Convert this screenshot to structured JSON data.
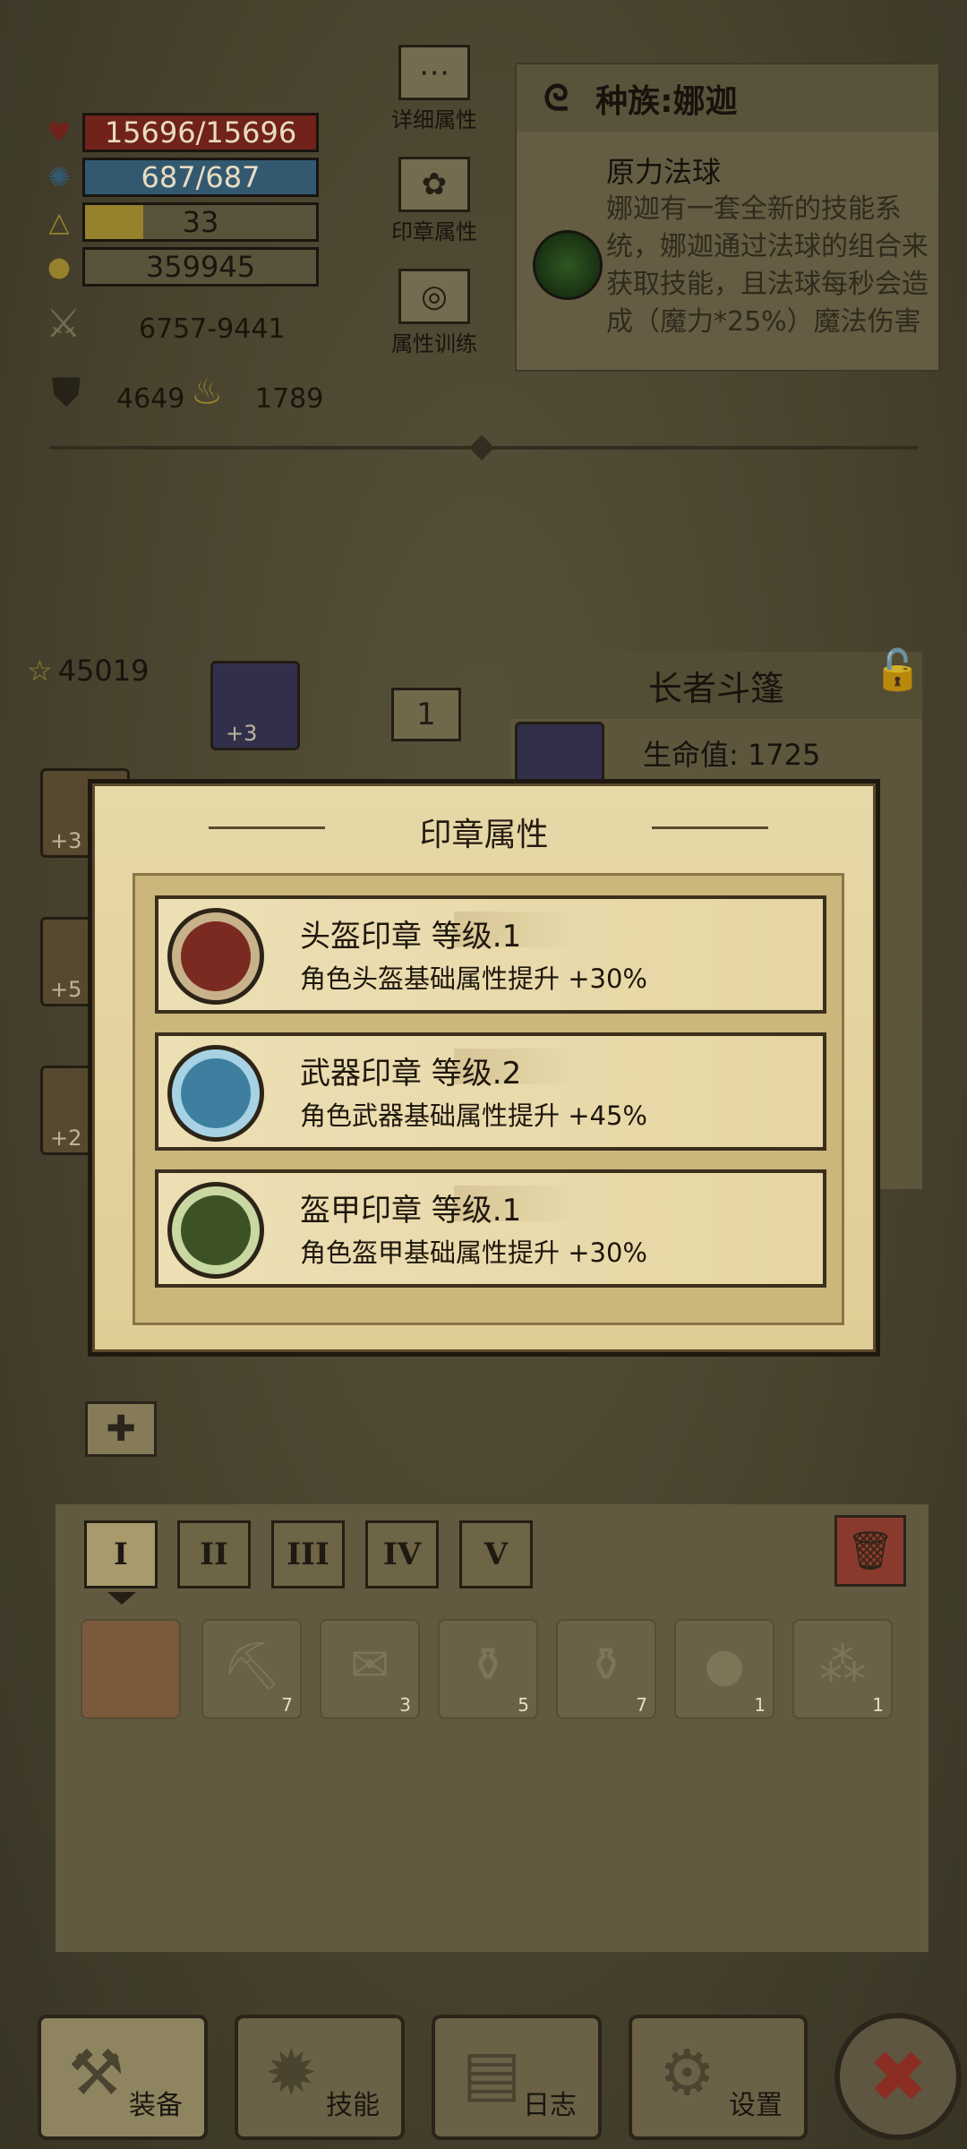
{
  "stats": {
    "hp": "15696/15696",
    "mp": "687/687",
    "level": "33",
    "gold": "359945",
    "attack": "6757-9441",
    "defense": "4649",
    "power": "1789"
  },
  "side_buttons": {
    "detail": "详细属性",
    "seal": "印章属性",
    "training": "属性训练"
  },
  "race": {
    "title": "种族:娜迦",
    "subtitle": "原力法球",
    "description": "娜迦有一套全新的技能系统，娜迦通过法球的组合来获取技能，且法球每秒会造成（魔力*25%）魔法伤害"
  },
  "equipment": {
    "score": "45019",
    "slot_number": "1",
    "helmet_badge": "+3",
    "item_name": "长者斗篷",
    "item_stat": "生命值: 1725",
    "left_badges": [
      "+3",
      "+5",
      "+2"
    ]
  },
  "modal": {
    "title": "印章属性",
    "seals": [
      {
        "name": "头盔印章 等级.1",
        "desc": "角色头盔基础属性提升  +30%",
        "color": "#7a2a20"
      },
      {
        "name": "武器印章 等级.2",
        "desc": "角色武器基础属性提升  +45%",
        "color": "#3e7fa0"
      },
      {
        "name": "盔甲印章 等级.1",
        "desc": "角色盔甲基础属性提升  +30%",
        "color": "#3d5224"
      }
    ]
  },
  "bag": {
    "tabs": [
      "I",
      "II",
      "III",
      "IV",
      "V"
    ],
    "counts": [
      "7",
      "3",
      "5",
      "7",
      "1",
      "1"
    ]
  },
  "nav": {
    "equip": "装备",
    "skills": "技能",
    "log": "日志",
    "settings": "设置"
  },
  "colors": {
    "hp": "#8a2a22",
    "mp": "#3f6d8a",
    "xp": "#b89e36",
    "modal_bg": "#e7d8a8"
  }
}
